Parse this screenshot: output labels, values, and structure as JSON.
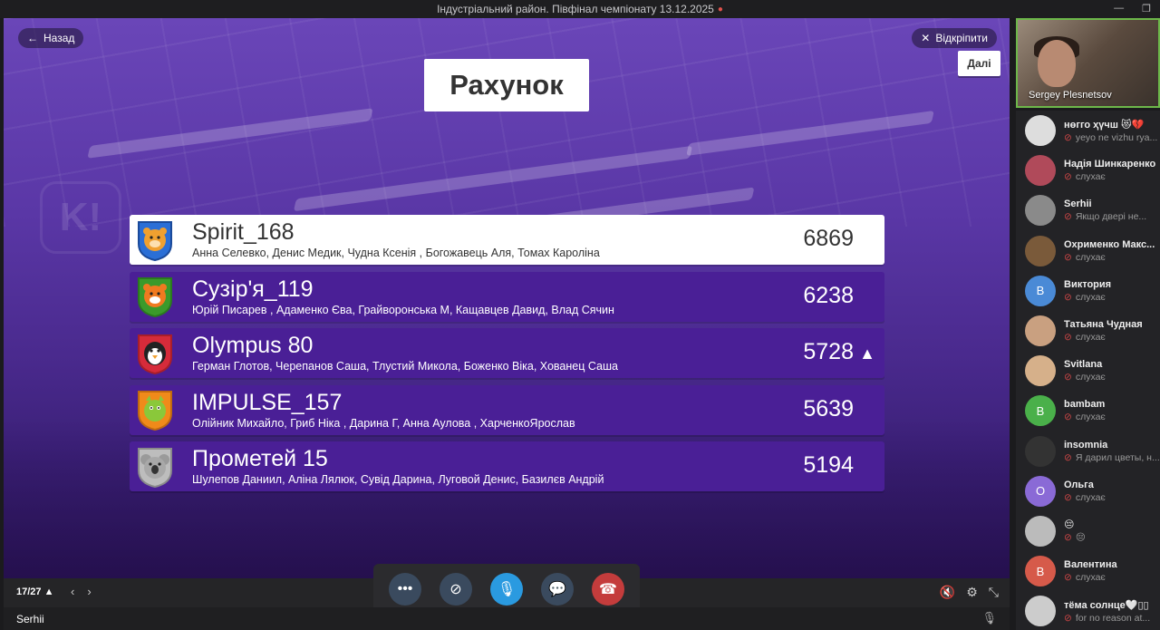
{
  "window": {
    "title": "Індустріальний район. Півфінал чемпіонату 13.12.2025",
    "rec": "●"
  },
  "stage": {
    "back_label": "Назад",
    "unpin_label": "Відкріпити",
    "next_label": "Далі",
    "title": "Рахунок"
  },
  "teams": [
    {
      "name": "Spirit_168",
      "members": "Анна Селевко, Денис Медик, Чудна Ксенія , Богожавець Аля, Томах Кароліна",
      "score": "6869",
      "avatar": "bear-icon",
      "color": "#2b6fd6",
      "arrow": ""
    },
    {
      "name": "Сузір'я_119",
      "members": "Юрій Писарев , Адаменко Єва, Грайворонська М, Кащавцев Давид, Влад Сячин",
      "score": "6238",
      "avatar": "tiger-icon",
      "color": "#3b9a2b",
      "arrow": ""
    },
    {
      "name": "Olympus 80",
      "members": "Герман Глотов, Черепанов Саша, Тлустий Микола, Боженко Віка, Хованец Саша",
      "score": "5728",
      "avatar": "penguin-icon",
      "color": "#d62b3a",
      "arrow": "▲"
    },
    {
      "name": "IMPULSE_157",
      "members": "Олійник Михайло, Гриб Ніка , Дарина Г, Анна Аулова , ХарченкоЯрослав",
      "score": "5639",
      "avatar": "dragon-icon",
      "color": "#f08a1a",
      "arrow": ""
    },
    {
      "name": "Прометей 15",
      "members": "Шулепов Даниил, Аліна Лялюк, Сувід Дарина, Луговой Денис, Базилєв Андрій",
      "score": "5194",
      "avatar": "koala-icon",
      "color": "#a8a8a8",
      "arrow": ""
    }
  ],
  "toolbar": {
    "page": "17/27 ▲"
  },
  "bottom": {
    "user": "Serhii"
  },
  "video": {
    "name": "Sergey Plesnetsov"
  },
  "participants": [
    {
      "name": "нөгго ҳүчш 😻💔",
      "status": "yeyo ne vizhu rya...",
      "color": "#ddd",
      "letter": ""
    },
    {
      "name": "Надія Шинкаренко",
      "status": "слухає",
      "color": "#b04a5a",
      "letter": ""
    },
    {
      "name": "Serhii",
      "status": "Якщо двері не...",
      "color": "#8a8a8a",
      "letter": ""
    },
    {
      "name": "Охрименко Макс...",
      "status": "слухає",
      "color": "#7a5a3a",
      "letter": ""
    },
    {
      "name": "Виктория",
      "status": "слухає",
      "color": "#4a8ad6",
      "letter": "В"
    },
    {
      "name": "Татьяна Чудная",
      "status": "слухає",
      "color": "#c9a080",
      "letter": ""
    },
    {
      "name": "Svitlana",
      "status": "слухає",
      "color": "#d6b08a",
      "letter": ""
    },
    {
      "name": "bambam",
      "status": "слухає",
      "color": "#4ab04a",
      "letter": "B"
    },
    {
      "name": "insomnia",
      "status": "Я дарил цветы, н...",
      "color": "#333",
      "letter": ""
    },
    {
      "name": "Ольга",
      "status": "слухає",
      "color": "#8a6ad6",
      "letter": "О"
    },
    {
      "name": "😔",
      "status": "😔",
      "color": "#bbb",
      "letter": ""
    },
    {
      "name": "Валентина",
      "status": "слухає",
      "color": "#d65a4a",
      "letter": "В"
    },
    {
      "name": "тёма солнце🤍▯▯",
      "status": "for no reason at...",
      "color": "#ccc",
      "letter": ""
    }
  ]
}
